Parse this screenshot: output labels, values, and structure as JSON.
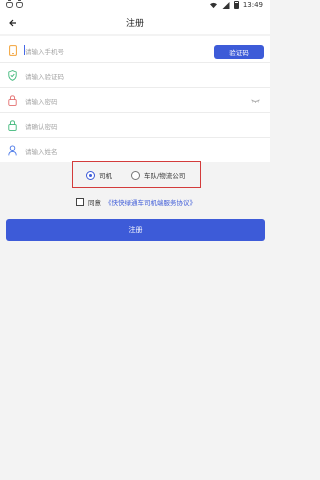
{
  "status_bar": {
    "time": "13:49",
    "left_icons": [
      "bug-icon",
      "bug-icon"
    ],
    "right_icons": [
      "wifi-icon",
      "signal-icon",
      "battery-icon"
    ]
  },
  "header": {
    "title": "注册",
    "back_icon": "arrow-left-icon"
  },
  "form": {
    "phone_placeholder": "请输入手机号",
    "code_placeholder": "请输入验证码",
    "password_placeholder": "请输入密码",
    "confirm_password_placeholder": "请确认密码",
    "name_placeholder": "请输入姓名",
    "verify_button_label": "验证码"
  },
  "role": {
    "options": [
      {
        "label": "司机",
        "selected": true
      },
      {
        "label": "车队/物流公司",
        "selected": false
      }
    ],
    "highlight_color": "#d33b3b"
  },
  "agreement": {
    "prefix": "同意",
    "link": "《快快绿通车司机端服务协议》",
    "checked": false
  },
  "submit": {
    "label": "注册"
  },
  "colors": {
    "accent": "#3d5bd8",
    "phone_icon": "#f2a33a",
    "code_icon": "#3fb87a",
    "password_icon": "#e36f6f",
    "confirm_icon": "#3fb87a",
    "name_icon": "#4a78e8"
  }
}
